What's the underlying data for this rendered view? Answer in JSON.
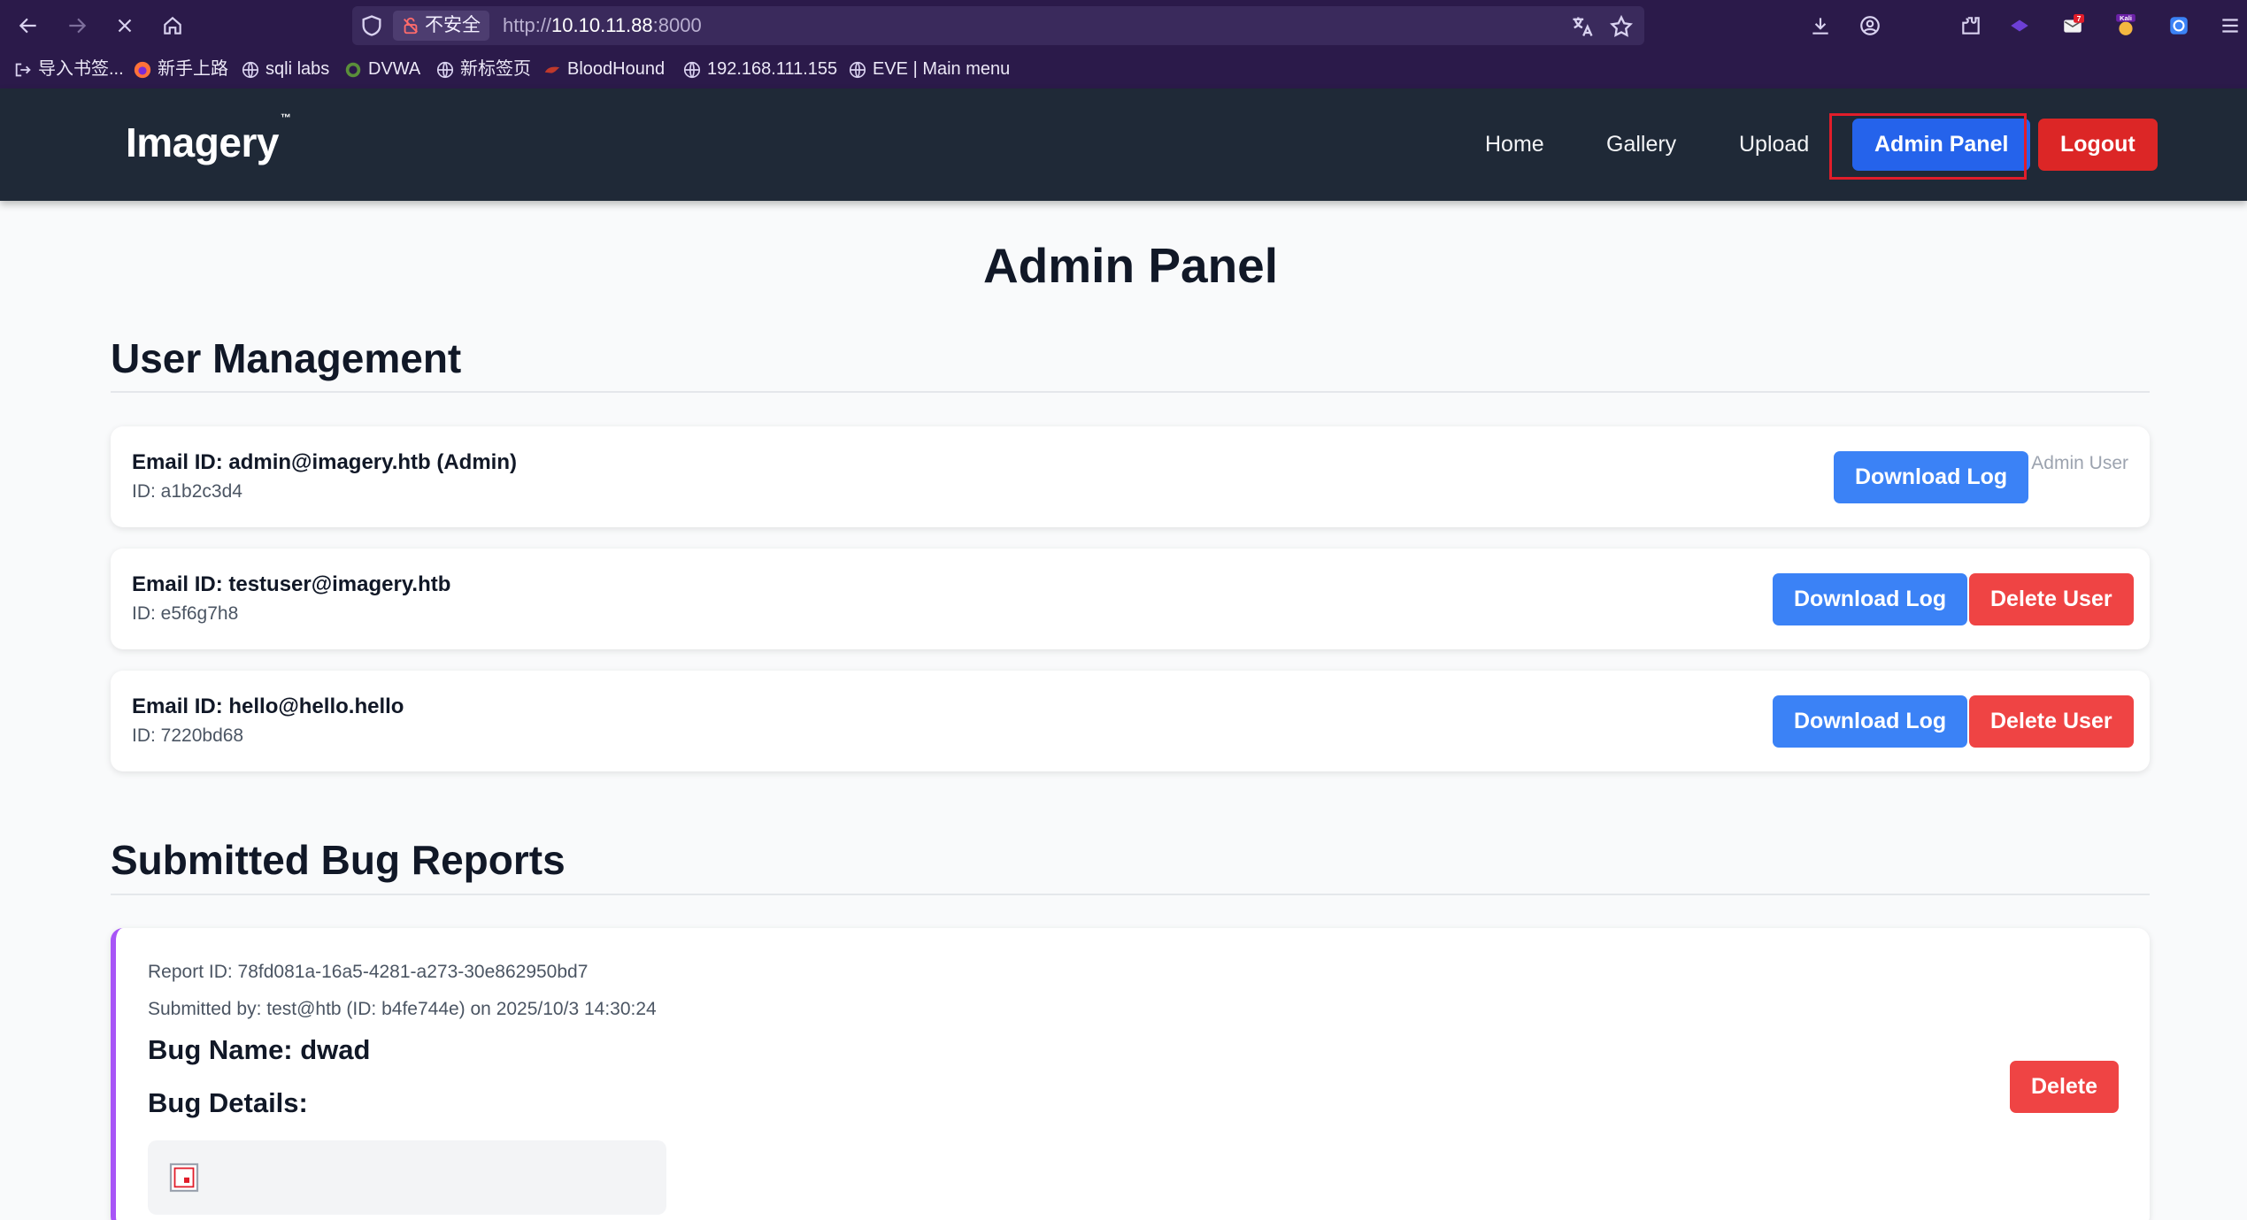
{
  "browser": {
    "url_insecure_label": "不安全",
    "url_scheme": "http://",
    "url_host": "10.10.11.88",
    "url_port": ":8000",
    "extension_badge": "7",
    "profile_badge": "Kali",
    "bookmarks": [
      {
        "label": "导入书签...",
        "icon": "import-icon"
      },
      {
        "label": "新手上路",
        "icon": "firefox-icon"
      },
      {
        "label": "sqli labs",
        "icon": "globe-icon"
      },
      {
        "label": "DVWA",
        "icon": "dvwa-icon"
      },
      {
        "label": "新标签页",
        "icon": "globe-icon"
      },
      {
        "label": "BloodHound",
        "icon": "bloodhound-icon"
      },
      {
        "label": "192.168.111.155",
        "icon": "globe-icon"
      },
      {
        "label": "EVE | Main menu",
        "icon": "globe-icon"
      }
    ]
  },
  "site": {
    "logo": "Imagery",
    "logo_mark": "™",
    "nav": {
      "home": "Home",
      "gallery": "Gallery",
      "upload": "Upload",
      "admin_panel": "Admin Panel",
      "logout": "Logout"
    },
    "colors": {
      "nav_bg": "#1f2937",
      "primary": "#3b82f6",
      "danger": "#ef4444",
      "report_accent": "#a855f7"
    }
  },
  "page": {
    "title": "Admin Panel",
    "user_section_title": "User Management",
    "bug_section_title": "Submitted Bug Reports"
  },
  "users": [
    {
      "email": "Email ID: admin@imagery.htb (Admin)",
      "id": "ID: a1b2c3d4",
      "download": "Download Log",
      "note": "Admin User"
    },
    {
      "email": "Email ID: testuser@imagery.htb",
      "id": "ID: e5f6g7h8",
      "download": "Download Log",
      "delete": "Delete User"
    },
    {
      "email": "Email ID: hello@hello.hello",
      "id": "ID: 7220bd68",
      "download": "Download Log",
      "delete": "Delete User"
    }
  ],
  "report": {
    "report_id": "Report ID: 78fd081a-16a5-4281-a273-30e862950bd7",
    "submitted_by": "Submitted by: test@htb (ID: b4fe744e) on 2025/10/3 14:30:24",
    "bug_name": "Bug Name: dwad",
    "bug_details_label": "Bug Details:",
    "delete": "Delete"
  }
}
